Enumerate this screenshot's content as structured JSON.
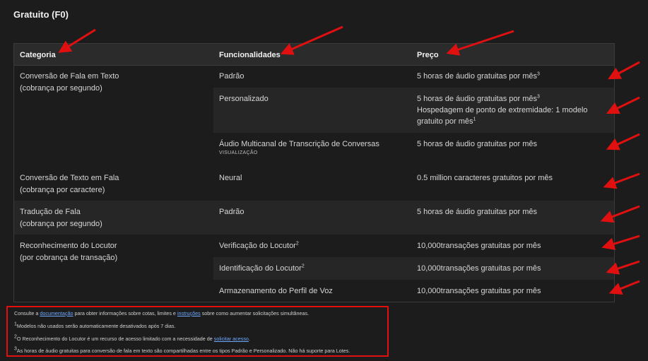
{
  "title": "Gratuito (F0)",
  "table": {
    "headers": [
      "Categoria",
      "Funcionalidades",
      "Preço"
    ],
    "rows": {
      "r1": {
        "cat1": "Conversão de Fala em Texto",
        "cat2": "(cobrança por segundo)",
        "feat": "Padrão",
        "price": "5 horas de áudio gratuitas por mês",
        "sup": "3"
      },
      "r2": {
        "feat": "Personalizado",
        "price1": "5 horas de áudio gratuitas por mês",
        "sup1": "3",
        "price2": "Hospedagem de ponto de extremidade: 1 modelo",
        "price3": "gratuito por mês",
        "sup3": "1"
      },
      "r3": {
        "feat": "Áudio Multicanal de Transcrição de Conversas",
        "preview": "VISUALIZAÇÃO",
        "price": "5 horas de áudio gratuitas por mês"
      },
      "r4": {
        "cat1": "Conversão de Texto em Fala",
        "cat2": "(cobrança por caractere)",
        "feat": "Neural",
        "price": "0.5 million caracteres gratuitos por mês"
      },
      "r5": {
        "cat1": "Tradução de Fala",
        "cat2": "(cobrança por segundo)",
        "feat": "Padrão",
        "price": "5 horas de áudio gratuitas por mês"
      },
      "r6": {
        "cat1": "Reconhecimento do Locutor",
        "cat2": "(por cobrança de transação)",
        "feat": "Verificação do Locutor",
        "sup": "2",
        "price": "10,000transações gratuitas por mês"
      },
      "r7": {
        "feat": "Identificação do Locutor",
        "sup": "2",
        "price": "10,000transações gratuitas por mês"
      },
      "r8": {
        "feat": "Armazenamento do Perfil de Voz",
        "price": "10,000transações gratuitas por mês"
      }
    }
  },
  "notes": {
    "n1": {
      "pre": "Consulte a ",
      "link1": "documentação",
      "mid": " para obter informações sobre cotas, limites e ",
      "link2": "instruções",
      "post": " sobre como aumentar solicitações simultâneas."
    },
    "n2": {
      "sup": "1",
      "text": "Modelos não usados serão automaticamente desativados após 7 dias."
    },
    "n3": {
      "sup": "2",
      "pre": "O Reconhecimento do Locutor é um recurso de acesso limitado com a necessidade de ",
      "link": "solicitar acesso",
      "post": "."
    },
    "n4": {
      "sup": "3",
      "text": "As horas de áudio gratuitas para conversão de fala em texto são compartilhadas entre os tipos Padrão e Personalizado. Não há suporte para Lotes."
    }
  },
  "colors": {
    "annotation": "#e01010",
    "link": "#6fa8ff"
  }
}
